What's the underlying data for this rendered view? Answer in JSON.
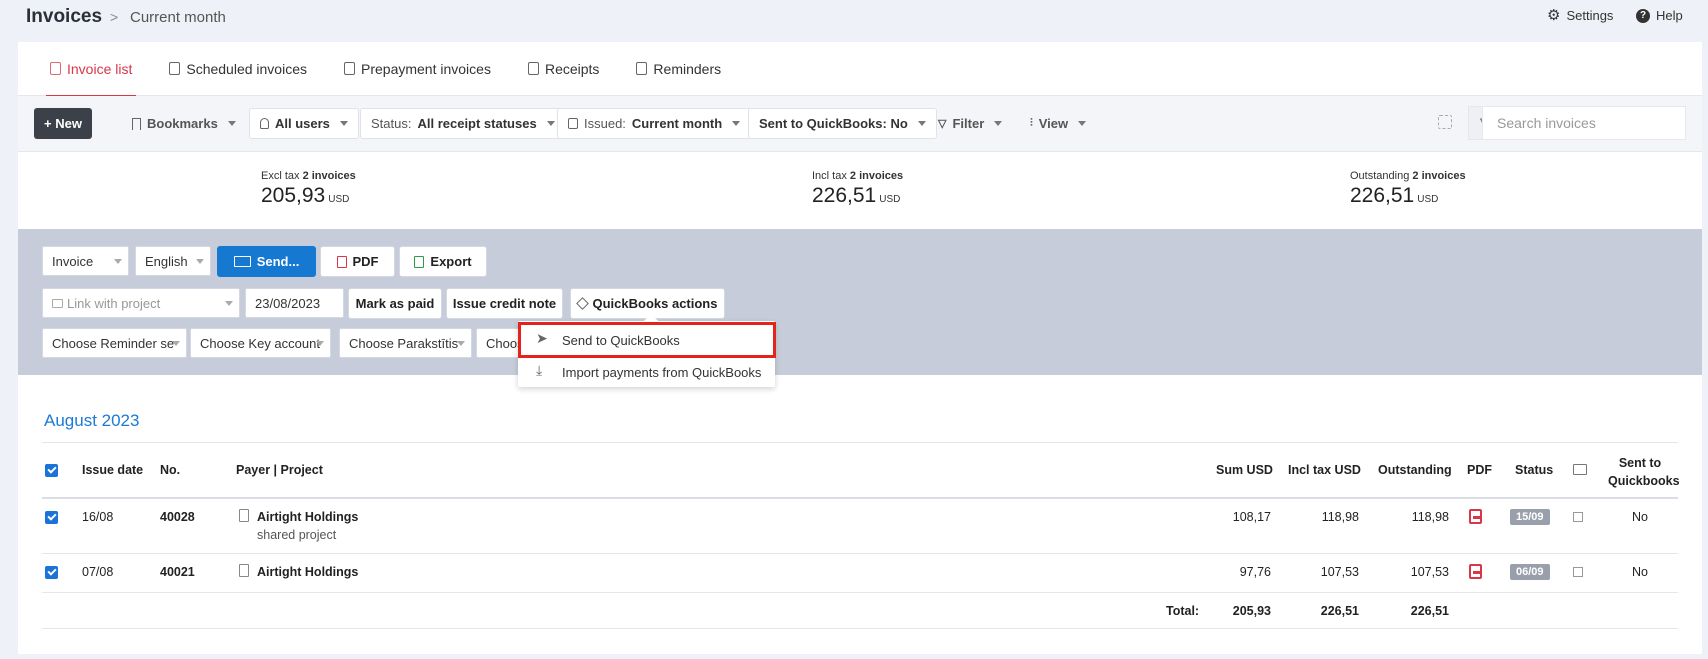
{
  "header": {
    "title": "Invoices",
    "breadcrumb_sep": ">",
    "breadcrumb": "Current month",
    "settings": "Settings",
    "help": "Help"
  },
  "tabs": [
    {
      "label": "Invoice list",
      "active": true
    },
    {
      "label": "Scheduled invoices"
    },
    {
      "label": "Prepayment invoices"
    },
    {
      "label": "Receipts"
    },
    {
      "label": "Reminders"
    }
  ],
  "toolbar": {
    "new": "+ New",
    "bookmarks": "Bookmarks",
    "users": "All users",
    "status_prefix": "Status:",
    "status_value": "All receipt statuses",
    "issued_prefix": "Issued:",
    "issued_value": "Current month",
    "sent_qb": "Sent to QuickBooks: No",
    "filter": "Filter",
    "view": "View",
    "search_placeholder": "Search invoices"
  },
  "summary": [
    {
      "label": "Excl tax",
      "count": "2 invoices",
      "value": "205,93",
      "currency": "USD"
    },
    {
      "label": "Incl tax",
      "count": "2 invoices",
      "value": "226,51",
      "currency": "USD"
    },
    {
      "label": "Outstanding",
      "count": "2 invoices",
      "value": "226,51",
      "currency": "USD"
    }
  ],
  "actions": {
    "doc_type": "Invoice",
    "language": "English",
    "send": "Send...",
    "pdf": "PDF",
    "export": "Export",
    "link_project": "Link with project",
    "date": "23/08/2023",
    "mark_paid": "Mark as paid",
    "credit_note": "Issue credit note",
    "qb_actions": "QuickBooks actions",
    "reminder": "Choose Reminder se",
    "key_account": "Choose Key account",
    "signer": "Choose Parakstītis",
    "more": "Choos"
  },
  "dropdown": {
    "send_qb": "Send to QuickBooks",
    "import_qb": "Import payments from QuickBooks"
  },
  "table": {
    "section": "August 2023",
    "headers": {
      "issue_date": "Issue date",
      "no": "No.",
      "payer": "Payer | Project",
      "sum": "Sum USD",
      "incl": "Incl tax USD",
      "outstanding": "Outstanding",
      "pdf": "PDF",
      "status": "Status",
      "sent1": "Sent to",
      "sent2": "Quickbooks"
    },
    "rows": [
      {
        "date": "16/08",
        "no": "40028",
        "payer": "Airtight Holdings",
        "project": "shared project",
        "sum": "108,17",
        "incl": "118,98",
        "outstanding": "118,98",
        "status": "15/09",
        "sent": "No"
      },
      {
        "date": "07/08",
        "no": "40021",
        "payer": "Airtight Holdings",
        "project": "",
        "sum": "97,76",
        "incl": "107,53",
        "outstanding": "107,53",
        "status": "06/09",
        "sent": "No"
      }
    ],
    "total_label": "Total:",
    "total_sum": "205,93",
    "total_incl": "226,51",
    "total_outstanding": "226,51"
  },
  "colors": {
    "accent_red": "#d9364a",
    "blue": "#1579d2",
    "highlight": "#e2241d"
  }
}
